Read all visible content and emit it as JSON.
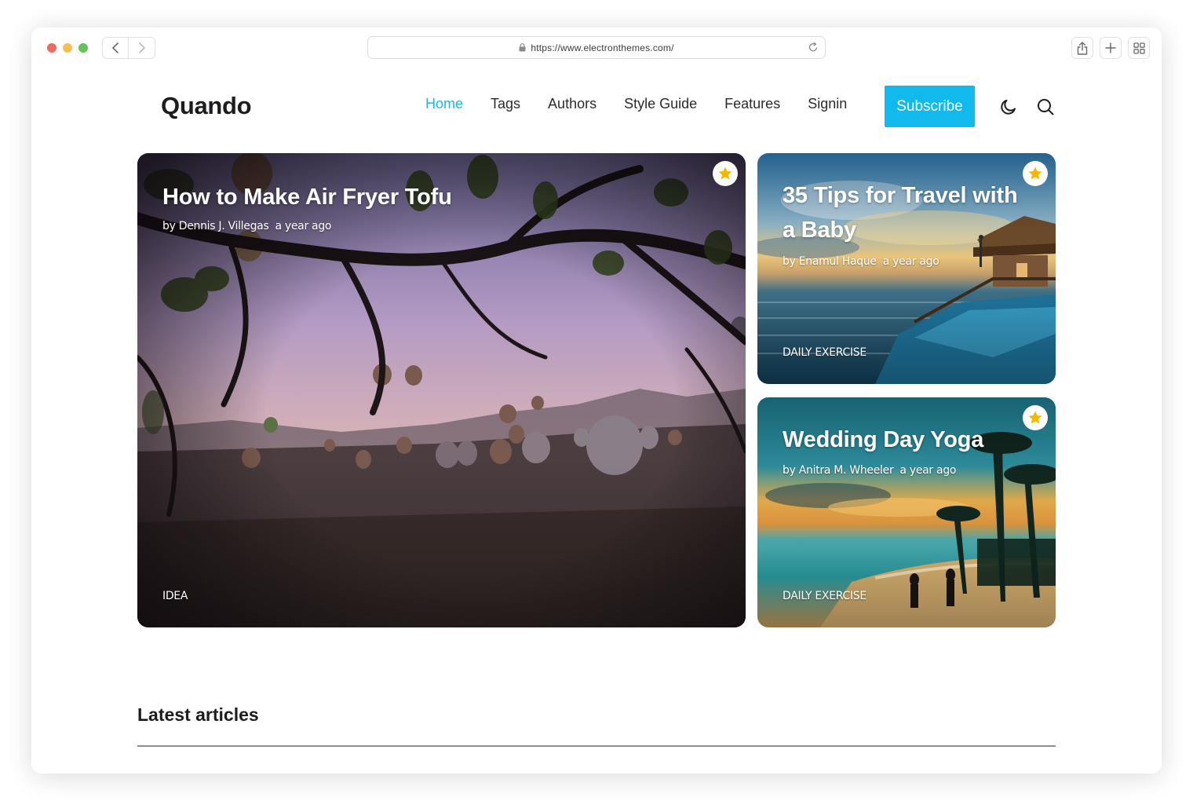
{
  "browser": {
    "url": "https://www.electronthemes.com/",
    "icons": [
      "back-icon",
      "forward-icon",
      "lock-icon",
      "reload-icon",
      "share-icon",
      "new-tab-icon",
      "tab-overview-icon"
    ]
  },
  "site": {
    "logo": "Quando",
    "nav": [
      {
        "label": "Home",
        "active": true
      },
      {
        "label": "Tags",
        "active": false
      },
      {
        "label": "Authors",
        "active": false
      },
      {
        "label": "Style Guide",
        "active": false
      },
      {
        "label": "Features",
        "active": false
      },
      {
        "label": "Signin",
        "active": false
      }
    ],
    "subscribe_label": "Subscribe",
    "accent_color": "#12b9ec"
  },
  "featured": [
    {
      "title": "How to Make Air Fryer Tofu",
      "author": "by Dennis J. Villegas",
      "time": "a year ago",
      "tag": "IDEA",
      "featured": true
    },
    {
      "title": "35 Tips for Travel with a Baby",
      "author": "by Enamul Haque",
      "time": "a year ago",
      "tag": "DAILY EXERCISE",
      "featured": true
    },
    {
      "title": "Wedding Day Yoga",
      "author": "by Anitra M. Wheeler",
      "time": "a year ago",
      "tag": "DAILY EXERCISE",
      "featured": true
    }
  ],
  "latest_heading": "Latest articles",
  "star_color": "#f5b800"
}
